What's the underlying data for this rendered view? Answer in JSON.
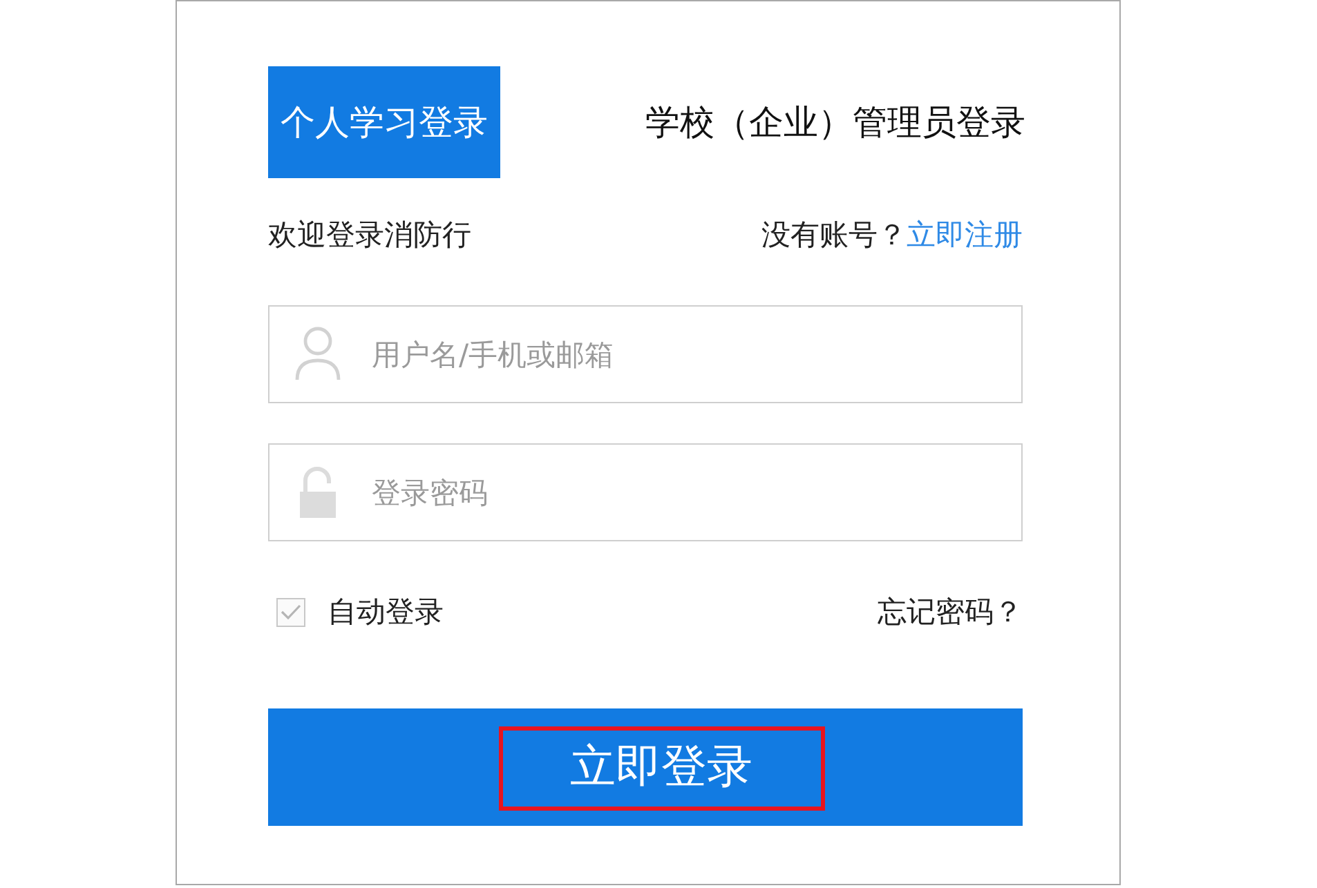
{
  "tabs": [
    {
      "label": "个人学习登录",
      "selected": true
    },
    {
      "label": "学校（企业）管理员登录",
      "selected": false
    }
  ],
  "welcome": {
    "text": "欢迎登录消防行",
    "prompt": "没有账号？",
    "register_link": "立即注册"
  },
  "fields": [
    {
      "kind": "user",
      "placeholder": "用户名/手机或邮箱"
    },
    {
      "kind": "password",
      "placeholder": "登录密码"
    }
  ],
  "auto_login": {
    "label": "自动登录",
    "checked": true
  },
  "forgot_link": "忘记密码？",
  "login_button": {
    "label": "立即登录",
    "highlighted": true
  }
}
